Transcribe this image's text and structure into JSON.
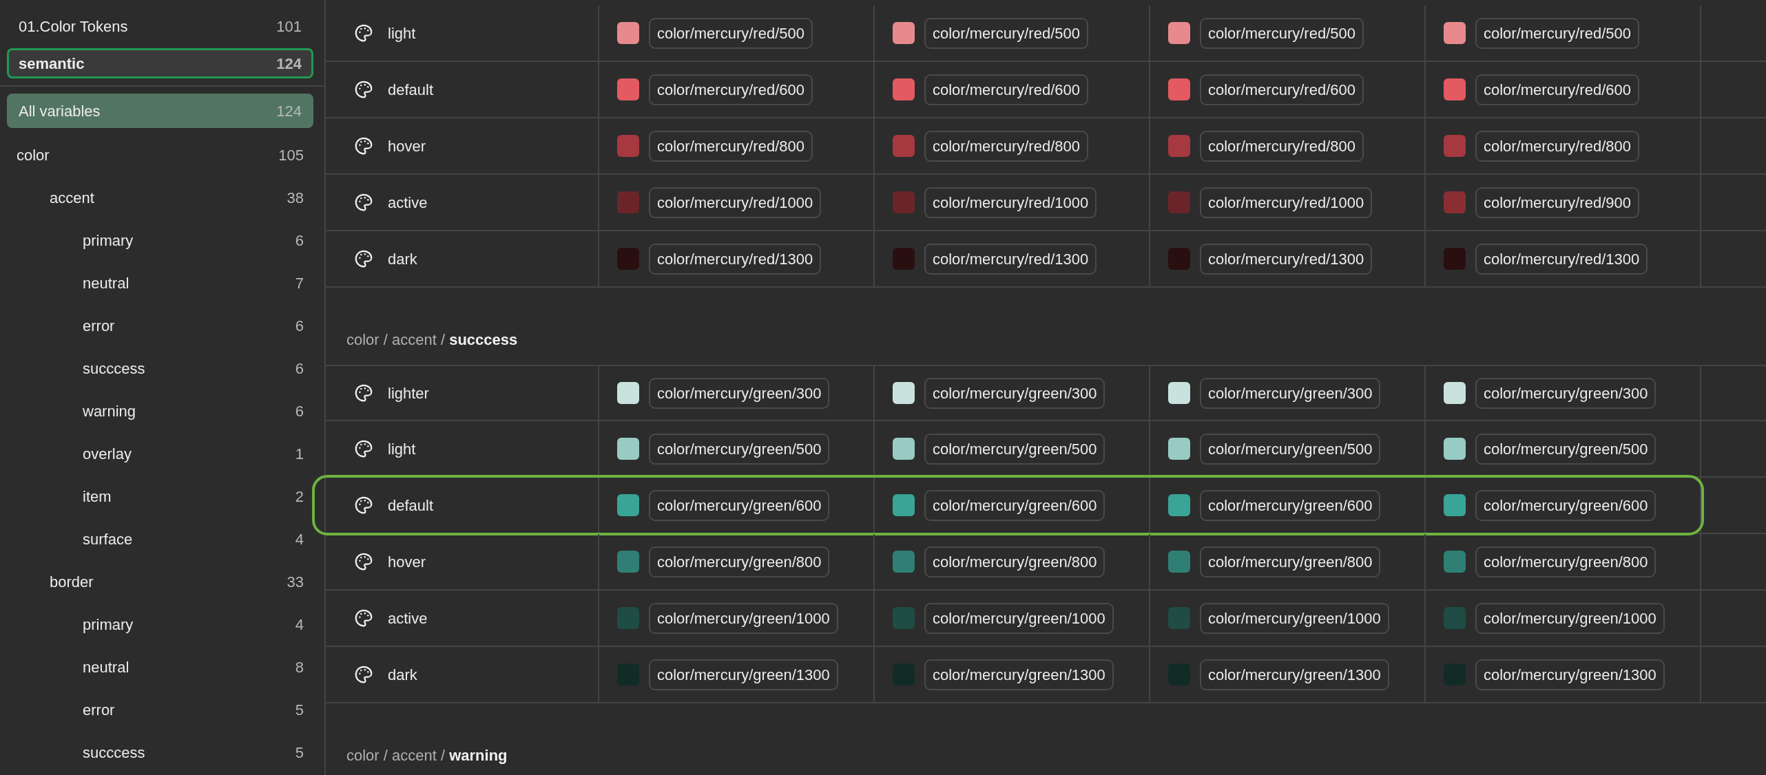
{
  "sidebar": {
    "collections": [
      {
        "label": "01.Color Tokens",
        "count": "101",
        "selected": false
      },
      {
        "label": "semantic",
        "count": "124",
        "selected": true
      }
    ],
    "groups": [
      {
        "label": "All variables",
        "count": "124",
        "selected": true
      },
      {
        "label": "color",
        "count": "105",
        "selected": false,
        "children": [
          {
            "label": "accent",
            "count": "38",
            "selected": false,
            "children": [
              {
                "label": "primary",
                "count": "6",
                "selected": false
              },
              {
                "label": "neutral",
                "count": "7",
                "selected": false
              },
              {
                "label": "error",
                "count": "6",
                "selected": false
              },
              {
                "label": "succcess",
                "count": "6",
                "selected": false
              },
              {
                "label": "warning",
                "count": "6",
                "selected": false
              },
              {
                "label": "overlay",
                "count": "1",
                "selected": false
              },
              {
                "label": "item",
                "count": "2",
                "selected": false
              },
              {
                "label": "surface",
                "count": "4",
                "selected": false
              }
            ]
          },
          {
            "label": "border",
            "count": "33",
            "selected": false,
            "children": [
              {
                "label": "primary",
                "count": "4",
                "selected": false
              },
              {
                "label": "neutral",
                "count": "8",
                "selected": false
              },
              {
                "label": "error",
                "count": "5",
                "selected": false
              },
              {
                "label": "succcess",
                "count": "5",
                "selected": false
              }
            ]
          }
        ]
      }
    ]
  },
  "sections": [
    {
      "rows": [
        {
          "name": "light",
          "highlighted": false,
          "values": [
            {
              "color": "#e88a8d",
              "token": "color/mercury/red/500"
            },
            {
              "color": "#e88a8d",
              "token": "color/mercury/red/500"
            },
            {
              "color": "#e88a8d",
              "token": "color/mercury/red/500"
            },
            {
              "color": "#e88a8d",
              "token": "color/mercury/red/500"
            }
          ]
        },
        {
          "name": "default",
          "highlighted": false,
          "values": [
            {
              "color": "#e35a62",
              "token": "color/mercury/red/600"
            },
            {
              "color": "#e35a62",
              "token": "color/mercury/red/600"
            },
            {
              "color": "#e35a62",
              "token": "color/mercury/red/600"
            },
            {
              "color": "#e35a62",
              "token": "color/mercury/red/600"
            }
          ]
        },
        {
          "name": "hover",
          "highlighted": false,
          "values": [
            {
              "color": "#a63840",
              "token": "color/mercury/red/800"
            },
            {
              "color": "#a63840",
              "token": "color/mercury/red/800"
            },
            {
              "color": "#a63840",
              "token": "color/mercury/red/800"
            },
            {
              "color": "#a63840",
              "token": "color/mercury/red/800"
            }
          ]
        },
        {
          "name": "active",
          "highlighted": false,
          "values": [
            {
              "color": "#6b2529",
              "token": "color/mercury/red/1000"
            },
            {
              "color": "#6b2529",
              "token": "color/mercury/red/1000"
            },
            {
              "color": "#6b2529",
              "token": "color/mercury/red/1000"
            },
            {
              "color": "#8b2e33",
              "token": "color/mercury/red/900"
            }
          ]
        },
        {
          "name": "dark",
          "highlighted": false,
          "values": [
            {
              "color": "#2a0f10",
              "token": "color/mercury/red/1300"
            },
            {
              "color": "#2a0f10",
              "token": "color/mercury/red/1300"
            },
            {
              "color": "#2a0f10",
              "token": "color/mercury/red/1300"
            },
            {
              "color": "#2a0f10",
              "token": "color/mercury/red/1300"
            }
          ]
        }
      ]
    },
    {
      "heading": "color / accent / **succcess**",
      "rows": [
        {
          "name": "lighter",
          "highlighted": false,
          "values": [
            {
              "color": "#c9e2de",
              "token": "color/mercury/green/300"
            },
            {
              "color": "#c9e2de",
              "token": "color/mercury/green/300"
            },
            {
              "color": "#c9e2de",
              "token": "color/mercury/green/300"
            },
            {
              "color": "#c9e2de",
              "token": "color/mercury/green/300"
            }
          ]
        },
        {
          "name": "light",
          "highlighted": false,
          "values": [
            {
              "color": "#98cbc3",
              "token": "color/mercury/green/500"
            },
            {
              "color": "#98cbc3",
              "token": "color/mercury/green/500"
            },
            {
              "color": "#98cbc3",
              "token": "color/mercury/green/500"
            },
            {
              "color": "#98cbc3",
              "token": "color/mercury/green/500"
            }
          ]
        },
        {
          "name": "default",
          "highlighted": true,
          "values": [
            {
              "color": "#3aa497",
              "token": "color/mercury/green/600"
            },
            {
              "color": "#3aa497",
              "token": "color/mercury/green/600"
            },
            {
              "color": "#3aa497",
              "token": "color/mercury/green/600"
            },
            {
              "color": "#3aa497",
              "token": "color/mercury/green/600"
            }
          ]
        },
        {
          "name": "hover",
          "highlighted": false,
          "values": [
            {
              "color": "#2f7f74",
              "token": "color/mercury/green/800"
            },
            {
              "color": "#2f7f74",
              "token": "color/mercury/green/800"
            },
            {
              "color": "#2f7f74",
              "token": "color/mercury/green/800"
            },
            {
              "color": "#2f7f74",
              "token": "color/mercury/green/800"
            }
          ]
        },
        {
          "name": "active",
          "highlighted": false,
          "values": [
            {
              "color": "#1f4c45",
              "token": "color/mercury/green/1000"
            },
            {
              "color": "#1f4c45",
              "token": "color/mercury/green/1000"
            },
            {
              "color": "#1f4c45",
              "token": "color/mercury/green/1000"
            },
            {
              "color": "#1f4c45",
              "token": "color/mercury/green/1000"
            }
          ]
        },
        {
          "name": "dark",
          "highlighted": false,
          "values": [
            {
              "color": "#122b27",
              "token": "color/mercury/green/1300"
            },
            {
              "color": "#122b27",
              "token": "color/mercury/green/1300"
            },
            {
              "color": "#122b27",
              "token": "color/mercury/green/1300"
            },
            {
              "color": "#122b27",
              "token": "color/mercury/green/1300"
            }
          ]
        }
      ]
    },
    {
      "heading": "color / accent / **warning**"
    }
  ]
}
